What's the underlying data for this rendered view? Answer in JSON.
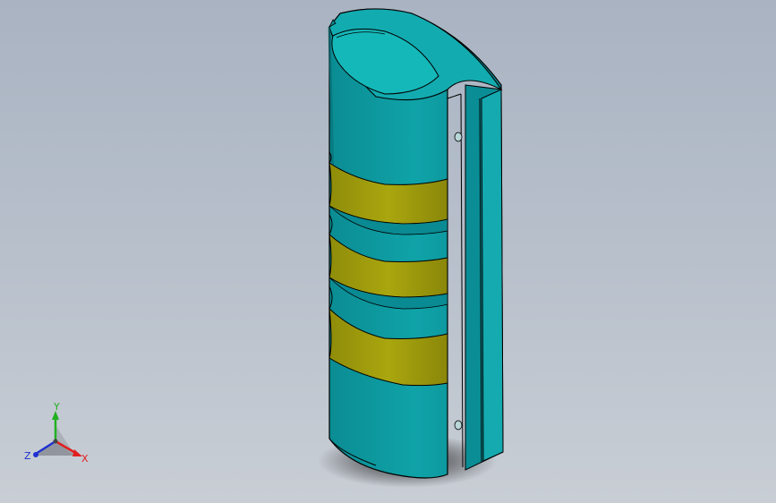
{
  "viewport": {
    "background_top": "#a9b3c2",
    "background_bottom": "#c9ced5"
  },
  "model": {
    "body_color": "#0fa3a8",
    "body_dark": "#0a8890",
    "top_face_color": "#13b3b5",
    "band_color": "#a6a20c",
    "band_dark": "#7d7a08",
    "edge_color": "#000000"
  },
  "triad": {
    "x_label": "X",
    "y_label": "Y",
    "z_label": "Z",
    "x_color": "#e02020",
    "y_color": "#20b020",
    "z_color": "#2030d0"
  }
}
